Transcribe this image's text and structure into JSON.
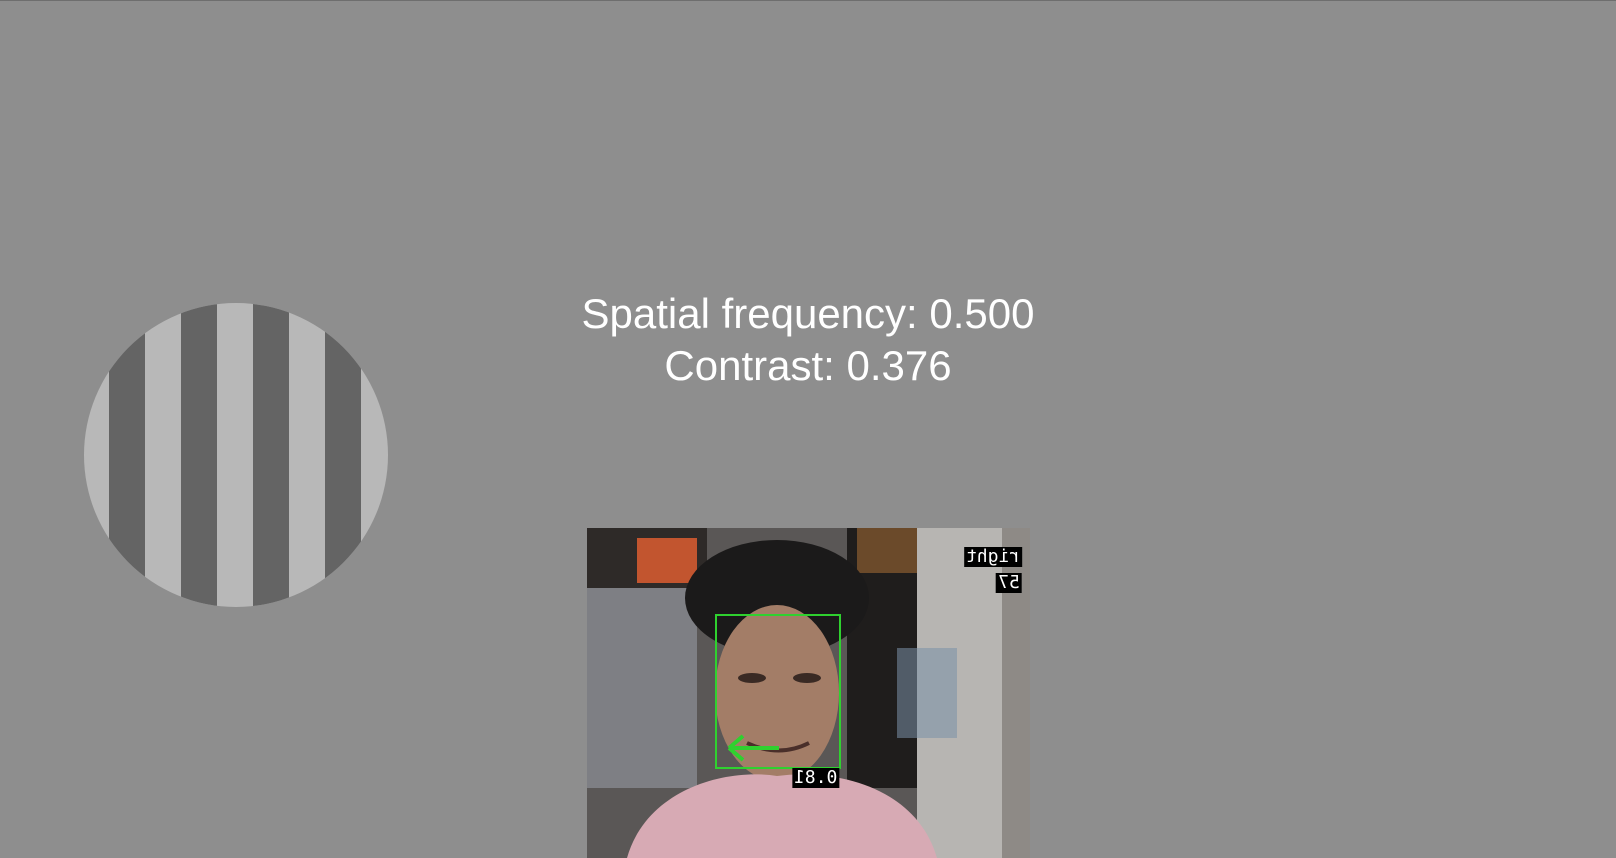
{
  "stimulus": {
    "spatial_frequency_text": "Spatial frequency: 0.500",
    "contrast_text": "Contrast: 0.376",
    "spatial_frequency": 0.5,
    "contrast": 0.376
  },
  "camera": {
    "direction_label": "right",
    "count_label": "57",
    "confidence_label": "0.81",
    "box_color": "#2fd12f"
  },
  "icons": {
    "gaze_arrow": "arrow-left-icon"
  }
}
